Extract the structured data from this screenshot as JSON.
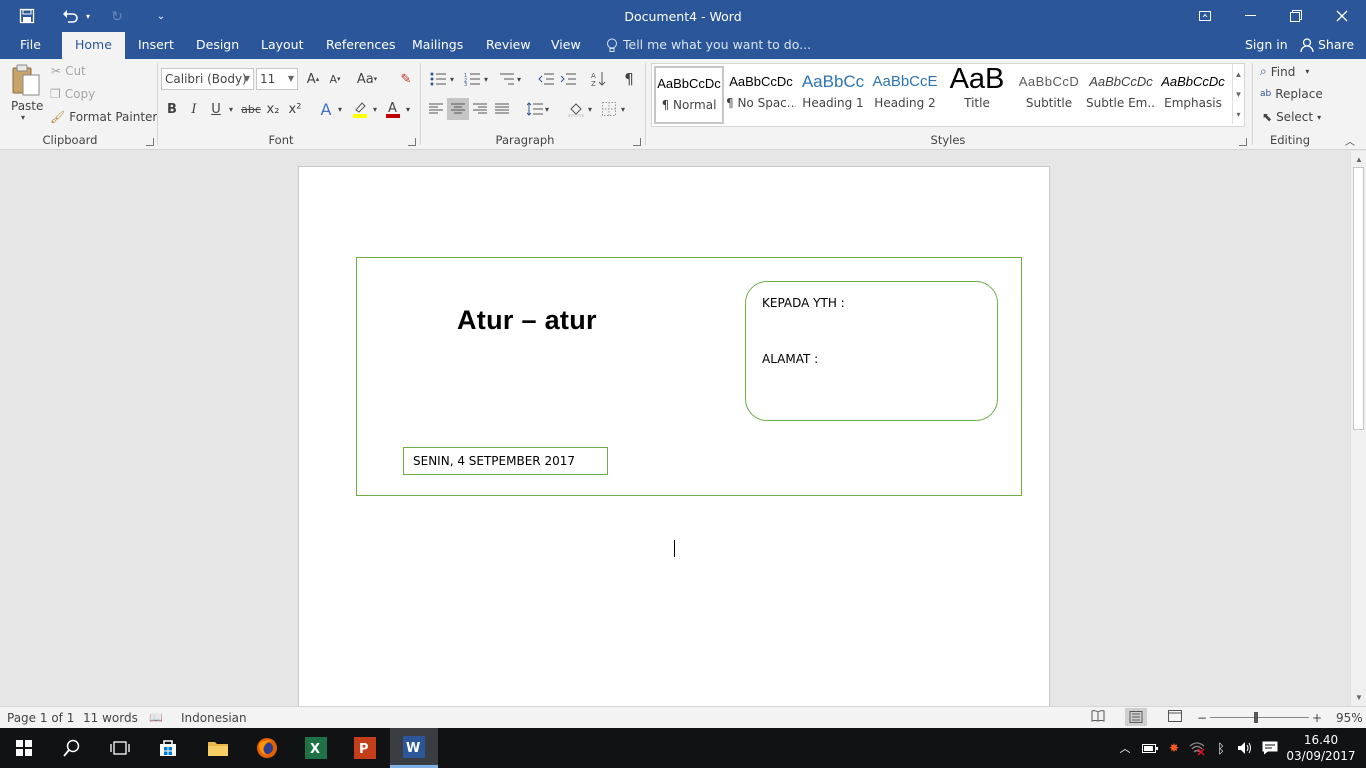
{
  "app": {
    "document_title": "Document4 - Word"
  },
  "tabs": [
    "File",
    "Home",
    "Insert",
    "Design",
    "Layout",
    "References",
    "Mailings",
    "Review",
    "View"
  ],
  "tell_me": {
    "placeholder": "Tell me what you want to do..."
  },
  "account": {
    "sign_in": "Sign in",
    "share": "Share"
  },
  "clipboard": {
    "paste": "Paste",
    "cut": "Cut",
    "copy": "Copy",
    "format_painter": "Format Painter",
    "label": "Clipboard"
  },
  "font": {
    "name": "Calibri (Body)",
    "size": "11",
    "case": "Aa",
    "bold": "B",
    "italic": "I",
    "underline": "U",
    "strikethrough": "abc",
    "subscript": "x₂",
    "superscript": "x²",
    "label": "Font"
  },
  "paragraph": {
    "label": "Paragraph"
  },
  "styles": {
    "label": "Styles",
    "items": [
      {
        "preview": "AaBbCcDc",
        "name": "¶ Normal"
      },
      {
        "preview": "AaBbCcDc",
        "name": "¶ No Spac..."
      },
      {
        "preview": "AaBbCc",
        "name": "Heading 1"
      },
      {
        "preview": "AaBbCcE",
        "name": "Heading 2"
      },
      {
        "preview": "AaB",
        "name": "Title"
      },
      {
        "preview": "AaBbCcD",
        "name": "Subtitle"
      },
      {
        "preview": "AaBbCcDc",
        "name": "Subtle Em..."
      },
      {
        "preview": "AaBbCcDc",
        "name": "Emphasis"
      }
    ]
  },
  "editing": {
    "find": "Find",
    "replace": "Replace",
    "select": "Select",
    "label": "Editing"
  },
  "document": {
    "heading": "Atur – atur",
    "recipient_label": "KEPADA YTH :",
    "address_label": "ALAMAT :",
    "date": "SENIN, 4 SETPEMBER 2017"
  },
  "status": {
    "page": "Page 1 of 1",
    "words": "11 words",
    "language": "Indonesian",
    "zoom": "95%"
  },
  "clock": {
    "time": "16.40",
    "date": "03/09/2017"
  },
  "colors": {
    "accent": "#2b579a",
    "shape_border": "#70ad47",
    "taskbar": "#101214"
  }
}
